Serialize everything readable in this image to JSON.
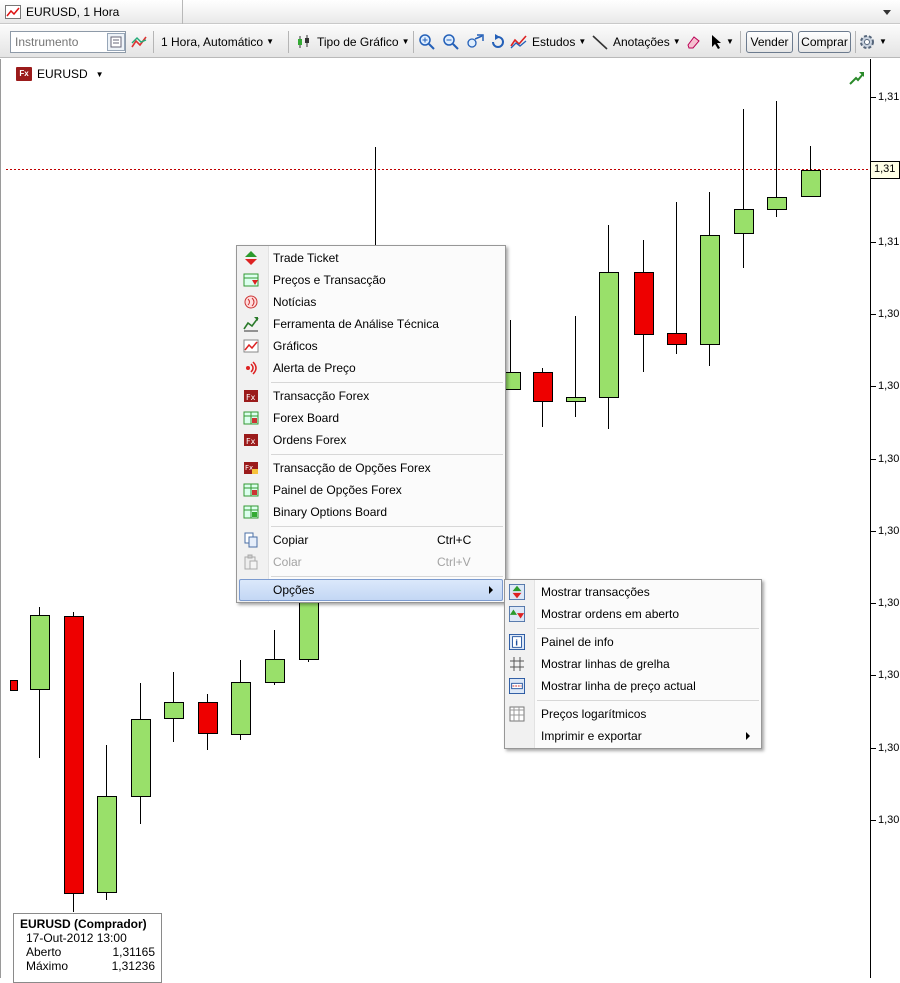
{
  "window": {
    "title": "EURUSD, 1 Hora"
  },
  "toolbar": {
    "instrument_placeholder": "Instrumento",
    "period_label": "1 Hora,  Automático",
    "chart_type_label": "Tipo de Gráfico",
    "studies_label": "Estudos",
    "annotations_label": "Anotações",
    "sell_label": "Vender",
    "buy_label": "Comprar"
  },
  "chart": {
    "symbol": "EURUSD",
    "symbol_badge": "Fx",
    "current_price_tag": "1,31",
    "y_axis_labels": [
      "1,31",
      "1,31",
      "1,31",
      "1,30",
      "1,30",
      "1,30",
      "1,30",
      "1,30",
      "1,30",
      "1,30",
      "1,30"
    ],
    "colors": {
      "up": "#99e06a",
      "down": "#ee0000",
      "price_line": "#c00000"
    }
  },
  "context_menu": {
    "items": [
      {
        "label": "Trade Ticket",
        "icon": "trade-ticket-icon"
      },
      {
        "label": "Preços e Transacção",
        "icon": "prices-icon"
      },
      {
        "label": "Notícias",
        "icon": "news-icon"
      },
      {
        "label": "Ferramenta de Análise Técnica",
        "icon": "analysis-icon"
      },
      {
        "label": "Gráficos",
        "icon": "chart-icon"
      },
      {
        "label": "Alerta de Preço",
        "icon": "alert-icon"
      },
      {
        "label": "Transacção Forex",
        "icon": "fx-icon"
      },
      {
        "label": "Forex Board",
        "icon": "board-icon"
      },
      {
        "label": "Ordens Forex",
        "icon": "fx-icon"
      },
      {
        "label": "Transacção de Opções Forex",
        "icon": "fx-options-icon"
      },
      {
        "label": "Painel de Opções Forex",
        "icon": "board-icon"
      },
      {
        "label": "Binary Options Board",
        "icon": "board-icon"
      },
      {
        "label": "Copiar",
        "shortcut": "Ctrl+C",
        "icon": "copy-icon"
      },
      {
        "label": "Colar",
        "shortcut": "Ctrl+V",
        "icon": "paste-icon"
      },
      {
        "label": "Opções",
        "icon": ""
      }
    ]
  },
  "submenu": {
    "items": [
      {
        "label": "Mostrar transacções",
        "icon": "trades-icon"
      },
      {
        "label": "Mostrar ordens em aberto",
        "icon": "orders-icon"
      },
      {
        "label": "Painel de info",
        "icon": "info-icon"
      },
      {
        "label": "Mostrar linhas de grelha",
        "icon": "grid-icon"
      },
      {
        "label": "Mostrar linha de preço actual",
        "icon": "price-line-icon"
      },
      {
        "label": "Preços logarítmicos",
        "icon": "log-icon"
      },
      {
        "label": "Imprimir e exportar",
        "icon": ""
      }
    ]
  },
  "info_box": {
    "title": "EURUSD (Comprador)",
    "datetime": "17-Out-2012 13:00",
    "rows": [
      {
        "label": "Aberto",
        "value": "1,31165"
      },
      {
        "label": "Máximo",
        "value": "1,31236"
      }
    ]
  }
}
